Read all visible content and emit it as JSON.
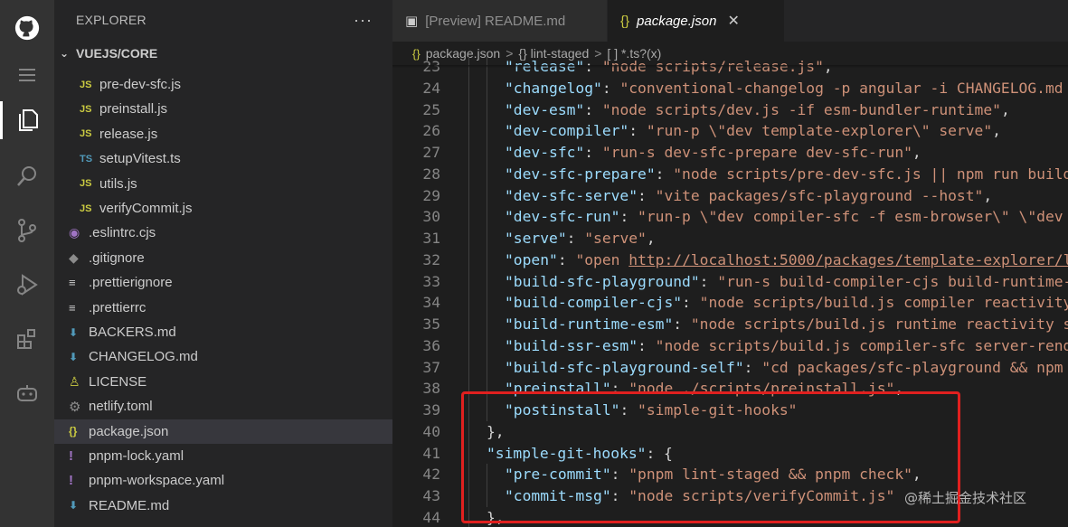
{
  "activity_bar": {
    "icons": [
      "github-icon",
      "menu-icon",
      "explorer-icon",
      "search-icon",
      "source-control-icon",
      "run-debug-icon",
      "extensions-icon",
      "copilot-icon"
    ]
  },
  "sidebar": {
    "header": "EXPLORER",
    "more": "···",
    "section": "VUEJS/CORE",
    "items": [
      {
        "icon": "JS",
        "type": "js",
        "label": "pre-dev-sfc.js",
        "indent": 2
      },
      {
        "icon": "JS",
        "type": "js",
        "label": "preinstall.js",
        "indent": 2
      },
      {
        "icon": "JS",
        "type": "js",
        "label": "release.js",
        "indent": 2
      },
      {
        "icon": "TS",
        "type": "ts",
        "label": "setupVitest.ts",
        "indent": 2
      },
      {
        "icon": "JS",
        "type": "js",
        "label": "utils.js",
        "indent": 2
      },
      {
        "icon": "JS",
        "type": "js",
        "label": "verifyCommit.js",
        "indent": 2
      },
      {
        "icon": "◉",
        "type": "eslint",
        "label": ".eslintrc.cjs",
        "indent": 1
      },
      {
        "icon": "◆",
        "type": "git",
        "label": ".gitignore",
        "indent": 1
      },
      {
        "icon": "≡",
        "type": "lines",
        "label": ".prettierignore",
        "indent": 1
      },
      {
        "icon": "≡",
        "type": "lines",
        "label": ".prettierrc",
        "indent": 1
      },
      {
        "icon": "⬇",
        "type": "md",
        "label": "BACKERS.md",
        "indent": 1
      },
      {
        "icon": "⬇",
        "type": "md",
        "label": "CHANGELOG.md",
        "indent": 1
      },
      {
        "icon": "♙",
        "type": "lic",
        "label": "LICENSE",
        "indent": 1
      },
      {
        "icon": "⚙",
        "type": "gear",
        "label": "netlify.toml",
        "indent": 1
      },
      {
        "icon": "{}",
        "type": "json",
        "label": "package.json",
        "indent": 1,
        "selected": true
      },
      {
        "icon": "!",
        "type": "yaml",
        "label": "pnpm-lock.yaml",
        "indent": 1
      },
      {
        "icon": "!",
        "type": "yaml",
        "label": "pnpm-workspace.yaml",
        "indent": 1
      },
      {
        "icon": "⬇",
        "type": "md",
        "label": "README.md",
        "indent": 1
      }
    ]
  },
  "tabs": [
    {
      "icon": "▣",
      "label": "[Preview] README.md",
      "active": false
    },
    {
      "icon": "{}",
      "label": "package.json",
      "active": true,
      "close": "✕"
    }
  ],
  "breadcrumb": {
    "file_icon": "{}",
    "parts": [
      "package.json",
      "{} lint-staged",
      "[ ] *.ts?(x)"
    ],
    "separator": ">"
  },
  "editor": {
    "lines": [
      {
        "n": "23",
        "indent": 2,
        "tokens": [
          [
            "k",
            "\"release\""
          ],
          [
            "p",
            ": "
          ],
          [
            "s",
            "\"node scripts/release.js\""
          ],
          [
            "p",
            ","
          ]
        ]
      },
      {
        "n": "24",
        "indent": 2,
        "tokens": [
          [
            "k",
            "\"changelog\""
          ],
          [
            "p",
            ": "
          ],
          [
            "s",
            "\"conventional-changelog -p angular -i CHANGELOG.md -"
          ]
        ]
      },
      {
        "n": "25",
        "indent": 2,
        "tokens": [
          [
            "k",
            "\"dev-esm\""
          ],
          [
            "p",
            ": "
          ],
          [
            "s",
            "\"node scripts/dev.js -if esm-bundler-runtime\""
          ],
          [
            "p",
            ","
          ]
        ]
      },
      {
        "n": "26",
        "indent": 2,
        "tokens": [
          [
            "k",
            "\"dev-compiler\""
          ],
          [
            "p",
            ": "
          ],
          [
            "s",
            "\"run-p \\\"dev template-explorer\\\" serve\""
          ],
          [
            "p",
            ","
          ]
        ]
      },
      {
        "n": "27",
        "indent": 2,
        "tokens": [
          [
            "k",
            "\"dev-sfc\""
          ],
          [
            "p",
            ": "
          ],
          [
            "s",
            "\"run-s dev-sfc-prepare dev-sfc-run\""
          ],
          [
            "p",
            ","
          ]
        ]
      },
      {
        "n": "28",
        "indent": 2,
        "tokens": [
          [
            "k",
            "\"dev-sfc-prepare\""
          ],
          [
            "p",
            ": "
          ],
          [
            "s",
            "\"node scripts/pre-dev-sfc.js || npm run build-"
          ]
        ]
      },
      {
        "n": "29",
        "indent": 2,
        "tokens": [
          [
            "k",
            "\"dev-sfc-serve\""
          ],
          [
            "p",
            ": "
          ],
          [
            "s",
            "\"vite packages/sfc-playground --host\""
          ],
          [
            "p",
            ","
          ]
        ]
      },
      {
        "n": "30",
        "indent": 2,
        "tokens": [
          [
            "k",
            "\"dev-sfc-run\""
          ],
          [
            "p",
            ": "
          ],
          [
            "s",
            "\"run-p \\\"dev compiler-sfc -f esm-browser\\\" \\\"dev v"
          ]
        ]
      },
      {
        "n": "31",
        "indent": 2,
        "tokens": [
          [
            "k",
            "\"serve\""
          ],
          [
            "p",
            ": "
          ],
          [
            "s",
            "\"serve\""
          ],
          [
            "p",
            ","
          ]
        ]
      },
      {
        "n": "32",
        "indent": 2,
        "tokens": [
          [
            "k",
            "\"open\""
          ],
          [
            "p",
            ": "
          ],
          [
            "s",
            "\"open "
          ],
          [
            "url",
            "http://localhost:5000/packages/template-explorer/lo"
          ]
        ]
      },
      {
        "n": "33",
        "indent": 2,
        "tokens": [
          [
            "k",
            "\"build-sfc-playground\""
          ],
          [
            "p",
            ": "
          ],
          [
            "s",
            "\"run-s build-compiler-cjs build-runtime-e"
          ]
        ]
      },
      {
        "n": "34",
        "indent": 2,
        "tokens": [
          [
            "k",
            "\"build-compiler-cjs\""
          ],
          [
            "p",
            ": "
          ],
          [
            "s",
            "\"node scripts/build.js compiler reactivity-"
          ]
        ]
      },
      {
        "n": "35",
        "indent": 2,
        "tokens": [
          [
            "k",
            "\"build-runtime-esm\""
          ],
          [
            "p",
            ": "
          ],
          [
            "s",
            "\"node scripts/build.js runtime reactivity sh"
          ]
        ]
      },
      {
        "n": "36",
        "indent": 2,
        "tokens": [
          [
            "k",
            "\"build-ssr-esm\""
          ],
          [
            "p",
            ": "
          ],
          [
            "s",
            "\"node scripts/build.js compiler-sfc server-rende"
          ]
        ]
      },
      {
        "n": "37",
        "indent": 2,
        "tokens": [
          [
            "k",
            "\"build-sfc-playground-self\""
          ],
          [
            "p",
            ": "
          ],
          [
            "s",
            "\"cd packages/sfc-playground && npm r"
          ]
        ]
      },
      {
        "n": "38",
        "indent": 2,
        "tokens": [
          [
            "k",
            "\"preinstall\""
          ],
          [
            "p",
            ": "
          ],
          [
            "s",
            "\"node ./scripts/preinstall.js\""
          ],
          [
            "p",
            ","
          ]
        ]
      },
      {
        "n": "39",
        "indent": 2,
        "tokens": [
          [
            "k",
            "\"postinstall\""
          ],
          [
            "p",
            ": "
          ],
          [
            "s",
            "\"simple-git-hooks\""
          ]
        ]
      },
      {
        "n": "40",
        "indent": 1,
        "tokens": [
          [
            "p",
            "},"
          ]
        ]
      },
      {
        "n": "41",
        "indent": 1,
        "tokens": [
          [
            "k",
            "\"simple-git-hooks\""
          ],
          [
            "p",
            ": {"
          ]
        ]
      },
      {
        "n": "42",
        "indent": 2,
        "tokens": [
          [
            "k",
            "\"pre-commit\""
          ],
          [
            "p",
            ": "
          ],
          [
            "s",
            "\"pnpm lint-staged && pnpm check\""
          ],
          [
            "p",
            ","
          ]
        ]
      },
      {
        "n": "43",
        "indent": 2,
        "tokens": [
          [
            "k",
            "\"commit-msg\""
          ],
          [
            "p",
            ": "
          ],
          [
            "s",
            "\"node scripts/verifyCommit.js\""
          ]
        ]
      },
      {
        "n": "44",
        "indent": 1,
        "tokens": [
          [
            "p",
            "},"
          ]
        ]
      }
    ]
  },
  "watermark": "@稀土掘金技术社区",
  "colors": {
    "background": "#1e1e1e",
    "sidebar": "#252526",
    "activity_bar": "#333333",
    "key": "#9cdcfe",
    "string": "#ce9178",
    "highlight_box": "#e0201f"
  }
}
